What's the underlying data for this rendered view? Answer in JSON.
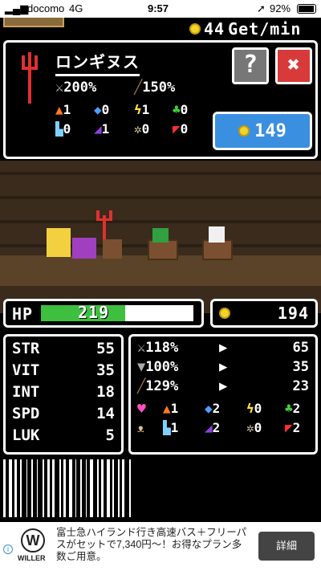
{
  "status_bar": {
    "carrier": "docomo",
    "network": "4G",
    "time": "9:57",
    "battery": "92%"
  },
  "income": {
    "value": "44",
    "label": "Get/min"
  },
  "weapon": {
    "name": "ロンギヌス",
    "attack_pct": "200%",
    "magic_pct": "150%",
    "elements": [
      "1",
      "0",
      "1",
      "0",
      "0",
      "1",
      "0",
      "0"
    ],
    "coin_price": "149",
    "help_label": "?",
    "close_label": "✖"
  },
  "hp": {
    "label": "HP",
    "value": "219",
    "fill_fraction": 0.55
  },
  "gold": {
    "value": "194"
  },
  "stats": [
    {
      "name": "STR",
      "value": "55"
    },
    {
      "name": "VIT",
      "value": "35"
    },
    {
      "name": "INT",
      "value": "18"
    },
    {
      "name": "SPD",
      "value": "14"
    },
    {
      "name": "LUK",
      "value": "5"
    }
  ],
  "modifiers": [
    {
      "pct": "118%",
      "result": "65"
    },
    {
      "pct": "100%",
      "result": "35"
    },
    {
      "pct": "129%",
      "result": "23"
    }
  ],
  "resistances": [
    "1",
    "2",
    "0",
    "2",
    "1",
    "2",
    "0",
    "2"
  ],
  "colors": {
    "accent_blue": "#3a8fe0",
    "close_red": "#d83a3a",
    "hp_green": "#3fbf3f",
    "coin": "#f2d42a"
  },
  "ad": {
    "brand": "WILLER",
    "text": "富士急ハイランド行き高速バス＋フリーパスがセットで7,340円〜！お得なプラン多数ご用意。",
    "button": "詳細"
  }
}
